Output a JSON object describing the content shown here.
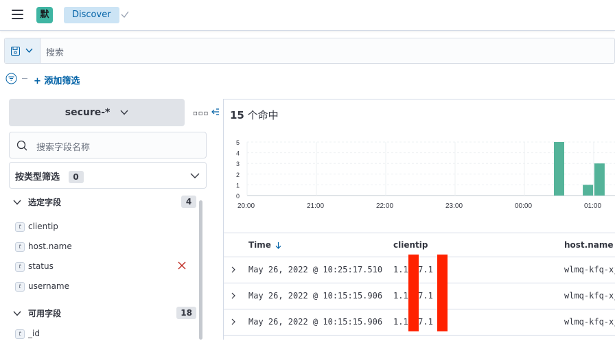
{
  "header": {
    "space_initial": "默",
    "app_tab_label": "Discover"
  },
  "query": {
    "search_placeholder": "搜索"
  },
  "filters": {
    "add_label": "+ 添加筛选"
  },
  "sidebar": {
    "index_pattern": "secure-*",
    "field_search_placeholder": "搜索字段名称",
    "type_filter_label": "按类型筛选",
    "type_filter_count": "0",
    "selected_section": {
      "title": "选定字段",
      "count": "4"
    },
    "selected_fields": [
      {
        "type": "t",
        "name": "clientip"
      },
      {
        "type": "t",
        "name": "host.name"
      },
      {
        "type": "t",
        "name": "status"
      },
      {
        "type": "t",
        "name": "username"
      }
    ],
    "available_section": {
      "title": "可用字段",
      "count": "18"
    },
    "available_fields": [
      {
        "type": "t",
        "name": "_id"
      }
    ]
  },
  "main": {
    "hits_count": "15",
    "hits_label": " 个命中"
  },
  "chart_data": {
    "type": "bar",
    "x_tick_labels": [
      "20:00",
      "21:00",
      "22:00",
      "23:00",
      "00:00",
      "01:00"
    ],
    "y_tick_labels": [
      "5",
      "4",
      "3",
      "2",
      "1",
      "0"
    ],
    "ylim": [
      0,
      5
    ],
    "bars": [
      {
        "x": "00:30",
        "value": 5
      },
      {
        "x": "00:55",
        "value": 1
      },
      {
        "x": "01:05",
        "value": 3
      }
    ],
    "bar_color": "#54b399"
  },
  "table": {
    "columns": [
      "Time",
      "clientip",
      "host.name"
    ],
    "rows": [
      {
        "time": "May 26, 2022 @ 10:25:17.510",
        "clientip": "1.1   .7.1",
        "host": "wlmq-kfq-xj"
      },
      {
        "time": "May 26, 2022 @ 10:15:15.906",
        "clientip": "1.1   .7.1",
        "host": "wlmq-kfq-xj"
      },
      {
        "time": "May 26, 2022 @ 10:15:15.906",
        "clientip": "1.1   .7.1",
        "host": "wlmq-kfq-xj"
      }
    ]
  },
  "colors": {
    "accent": "#0061a6",
    "avatar": "#3fb5a3",
    "remove": "#bd271e",
    "redaction": "#ff2200"
  }
}
